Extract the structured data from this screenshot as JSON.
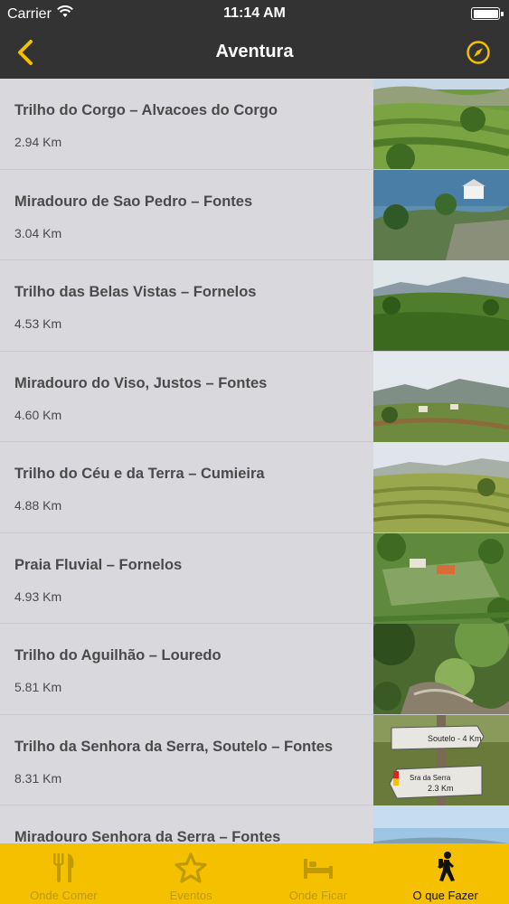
{
  "status_bar": {
    "carrier": "Carrier",
    "time": "11:14 AM"
  },
  "nav": {
    "title": "Aventura"
  },
  "colors": {
    "accent": "#f5c000",
    "nav_bg": "#333333",
    "list_bg": "#d9d8dc",
    "tab_inactive": "#bf9a00"
  },
  "items": [
    {
      "name": "Trilho do Corgo – Alvacoes do Corgo",
      "distance": "2.94 Km"
    },
    {
      "name": "Miradouro de Sao Pedro – Fontes",
      "distance": "3.04 Km"
    },
    {
      "name": "Trilho das Belas Vistas – Fornelos",
      "distance": "4.53 Km"
    },
    {
      "name": "Miradouro do Viso, Justos – Fontes",
      "distance": "4.60 Km"
    },
    {
      "name": "Trilho do Céu e da Terra – Cumieira",
      "distance": "4.88 Km"
    },
    {
      "name": "Praia Fluvial – Fornelos",
      "distance": "4.93 Km"
    },
    {
      "name": "Trilho do Aguilhão – Louredo",
      "distance": "5.81 Km"
    },
    {
      "name": "Trilho da Senhora da Serra, Soutelo – Fontes",
      "distance": "8.31 Km"
    },
    {
      "name": "Miradouro Senhora da Serra – Fontes",
      "distance": ""
    }
  ],
  "signpost": {
    "line1": "Soutelo - 4 Km",
    "line2": "Sra da Serra",
    "line3": "2.3 Km"
  },
  "tabs": [
    {
      "label": "Onde Comer",
      "icon": "fork-knife-icon"
    },
    {
      "label": "Eventos",
      "icon": "star-icon"
    },
    {
      "label": "Onde Ficar",
      "icon": "bed-icon"
    },
    {
      "label": "O que Fazer",
      "icon": "hiker-icon",
      "active": true
    }
  ]
}
